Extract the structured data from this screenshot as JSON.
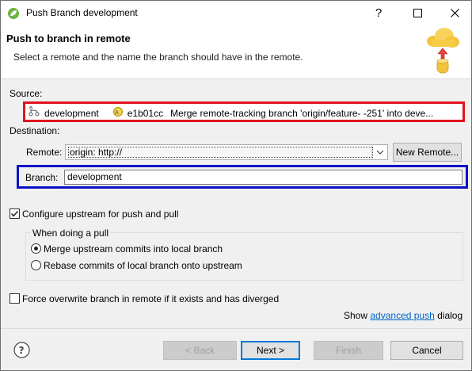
{
  "window": {
    "title": "Push Branch development"
  },
  "header": {
    "title": "Push to branch in remote",
    "description": "Select a remote and the name the branch should have in the remote."
  },
  "source": {
    "label": "Source:",
    "branch": "development",
    "commit_id": "e1b01cc",
    "commit_message": "Merge remote-tracking branch 'origin/feature-          -251' into deve..."
  },
  "destination": {
    "label": "Destination:",
    "remote_label": "Remote:",
    "remote_value": "origin: http://",
    "new_remote_button": "New Remote...",
    "branch_label": "Branch:",
    "branch_value": "development"
  },
  "options": {
    "configure_upstream": "Configure upstream for push and pull",
    "configure_upstream_checked": true,
    "pull_group_title": "When doing a pull",
    "merge_option": "Merge upstream commits into local branch",
    "merge_selected": true,
    "rebase_option": "Rebase commits of local branch onto upstream",
    "rebase_selected": false,
    "force_overwrite": "Force overwrite branch in remote if it exists and has diverged",
    "force_overwrite_checked": false
  },
  "advanced": {
    "prefix": "Show",
    "link": "advanced push",
    "suffix": "dialog"
  },
  "buttons": {
    "back": "< Back",
    "next": "Next >",
    "finish": "Finish",
    "cancel": "Cancel"
  },
  "colors": {
    "source_highlight": "#e0141e",
    "branch_highlight": "#0a10c8",
    "link": "#0066cc"
  },
  "icons": {
    "title": "eclipse-spring-icon",
    "help_window": "question-icon",
    "maximize": "maximize-icon",
    "close": "close-icon",
    "header": "cloud-upload-icon",
    "source_branch": "branch-icon",
    "commit": "commit-icon",
    "combo": "chevron-down-icon",
    "help": "help-icon"
  }
}
